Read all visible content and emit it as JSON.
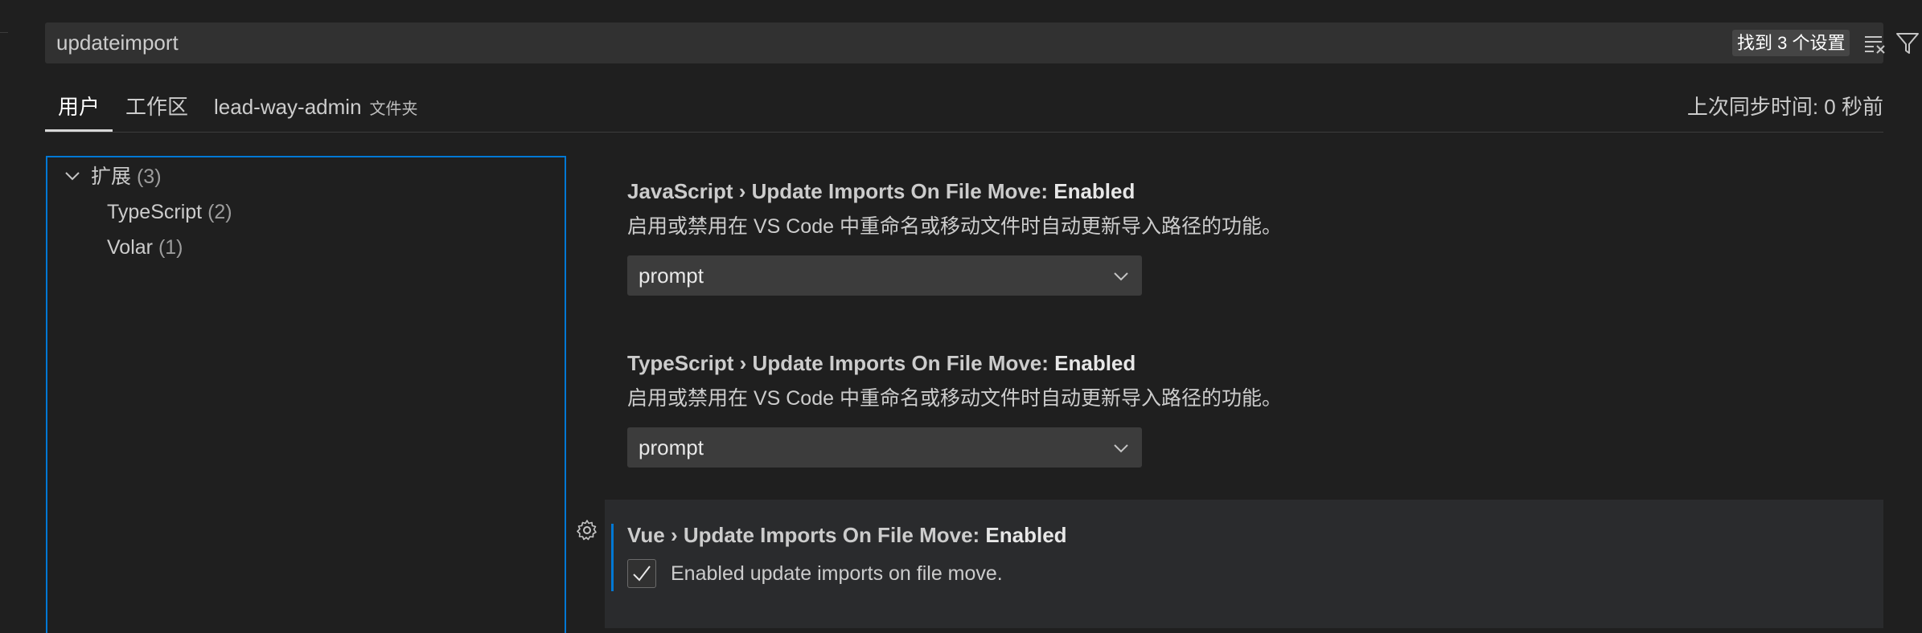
{
  "search": {
    "value": "updateimport",
    "result_count": "找到 3 个设置",
    "clear_filter_icon": "clear-all-icon",
    "filter_icon": "filter-icon"
  },
  "tabs": [
    {
      "label": "用户",
      "active": true
    },
    {
      "label": "工作区",
      "active": false
    },
    {
      "label": "lead-way-admin",
      "hint": "文件夹",
      "active": false
    }
  ],
  "sync_status": "上次同步时间: 0 秒前",
  "toc": {
    "root": {
      "label": "扩展",
      "count": "(3)",
      "icon": "chevron-down-icon"
    },
    "children": [
      {
        "label": "TypeScript",
        "count": "(2)"
      },
      {
        "label": "Volar",
        "count": "(1)"
      }
    ]
  },
  "settings": [
    {
      "category": "JavaScript › Update Imports On File Move: ",
      "name": "Enabled",
      "description": "启用或禁用在 VS Code 中重命名或移动文件时自动更新导入路径的功能。",
      "value": "prompt"
    },
    {
      "category": "TypeScript › Update Imports On File Move: ",
      "name": "Enabled",
      "description": "启用或禁用在 VS Code 中重命名或移动文件时自动更新导入路径的功能。",
      "value": "prompt"
    },
    {
      "category": "Vue › Update Imports On File Move: ",
      "name": "Enabled",
      "checkbox_label": "Enabled update imports on file move.",
      "checked": true
    }
  ],
  "colors": {
    "background": "#1f1f1f",
    "accent": "#0078d4",
    "input_bg": "#313131",
    "select_bg": "#3c3c3c"
  }
}
